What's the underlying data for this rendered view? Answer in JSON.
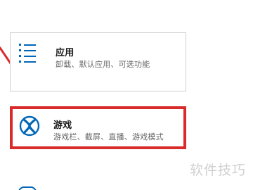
{
  "settings": {
    "apps": {
      "icon": "apps-list-icon",
      "title": "应用",
      "subtitle": "卸载、默认应用、可选功能"
    },
    "gaming": {
      "icon": "xbox-icon",
      "title": "游戏",
      "subtitle": "游戏栏、截屏、直播、游戏模式",
      "highlighted": true
    }
  },
  "annotation": {
    "arrow_color": "#d92b2b",
    "highlight_color": "#d92b2b"
  },
  "watermark": {
    "text": "软件技巧"
  },
  "colors": {
    "accent": "#0067b8",
    "title_text": "#1a1a1a",
    "subtitle_text": "#666666"
  }
}
